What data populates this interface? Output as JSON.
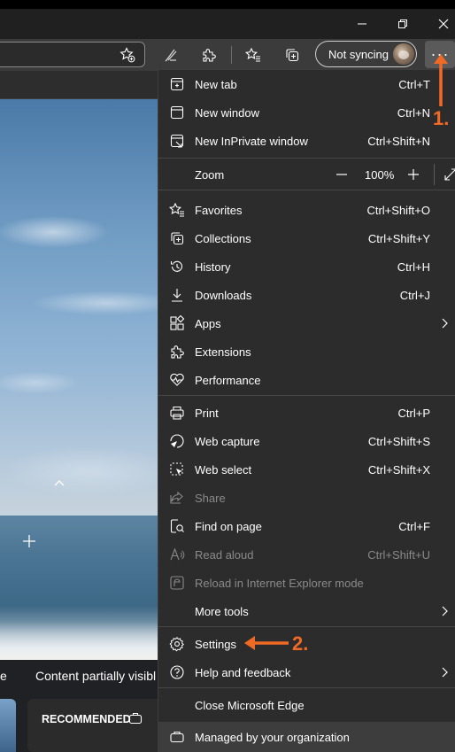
{
  "window": {
    "minimize_icon": "minimize-icon",
    "restore_icon": "restore-icon",
    "close_icon": "close-icon"
  },
  "toolbar": {
    "profile_label": "Not syncing",
    "more_label": "···"
  },
  "page": {
    "text_fragment_left": "e",
    "text_fragment_content": "Content partially visibl",
    "recommended_label": "RECOMMENDED"
  },
  "menu": {
    "new_tab": {
      "label": "New tab",
      "shortcut": "Ctrl+T"
    },
    "new_window": {
      "label": "New window",
      "shortcut": "Ctrl+N"
    },
    "new_inprivate": {
      "label": "New InPrivate window",
      "shortcut": "Ctrl+Shift+N"
    },
    "zoom": {
      "label": "Zoom",
      "value": "100%",
      "minus": "—",
      "plus": "+"
    },
    "favorites": {
      "label": "Favorites",
      "shortcut": "Ctrl+Shift+O"
    },
    "collections": {
      "label": "Collections",
      "shortcut": "Ctrl+Shift+Y"
    },
    "history": {
      "label": "History",
      "shortcut": "Ctrl+H"
    },
    "downloads": {
      "label": "Downloads",
      "shortcut": "Ctrl+J"
    },
    "apps": {
      "label": "Apps"
    },
    "extensions": {
      "label": "Extensions"
    },
    "performance": {
      "label": "Performance"
    },
    "print": {
      "label": "Print",
      "shortcut": "Ctrl+P"
    },
    "web_capture": {
      "label": "Web capture",
      "shortcut": "Ctrl+Shift+S"
    },
    "web_select": {
      "label": "Web select",
      "shortcut": "Ctrl+Shift+X"
    },
    "share": {
      "label": "Share"
    },
    "find_on_page": {
      "label": "Find on page",
      "shortcut": "Ctrl+F"
    },
    "read_aloud": {
      "label": "Read aloud",
      "shortcut": "Ctrl+Shift+U"
    },
    "reload_ie": {
      "label": "Reload in Internet Explorer mode"
    },
    "more_tools": {
      "label": "More tools"
    },
    "settings": {
      "label": "Settings"
    },
    "help": {
      "label": "Help and feedback"
    },
    "close_edge": {
      "label": "Close Microsoft Edge"
    },
    "managed": {
      "label": "Managed by your organization"
    }
  },
  "annotations": {
    "step1": "1.",
    "step2": "2.",
    "accent_color": "#f16a25"
  },
  "colors": {
    "menu_bg": "#2c2c2c",
    "menu_text": "#ffffff",
    "disabled_text": "#8a8a8a",
    "toolbar_bg": "#3b3b3b"
  }
}
